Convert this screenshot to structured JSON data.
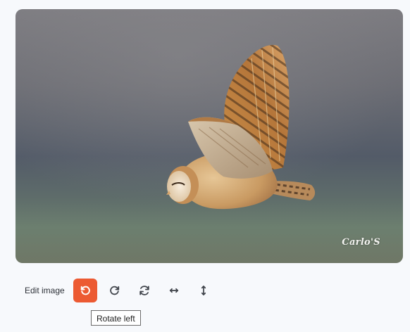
{
  "image": {
    "subject": "Barn owl in flight",
    "watermark": "Carlo'S"
  },
  "toolbar": {
    "label": "Edit image",
    "buttons": [
      {
        "name": "rotate-left",
        "icon": "rotate-left-icon",
        "active": true
      },
      {
        "name": "rotate-right",
        "icon": "rotate-right-icon",
        "active": false
      },
      {
        "name": "reset-rotation",
        "icon": "refresh-icon",
        "active": false
      },
      {
        "name": "flip-horizontal",
        "icon": "arrows-horizontal-icon",
        "active": false
      },
      {
        "name": "flip-vertical",
        "icon": "arrows-vertical-icon",
        "active": false
      }
    ]
  },
  "tooltip": {
    "text": "Rotate left"
  },
  "colors": {
    "accent": "#ec5a32",
    "icon": "#3f434a",
    "background": "#f7f9fc"
  }
}
